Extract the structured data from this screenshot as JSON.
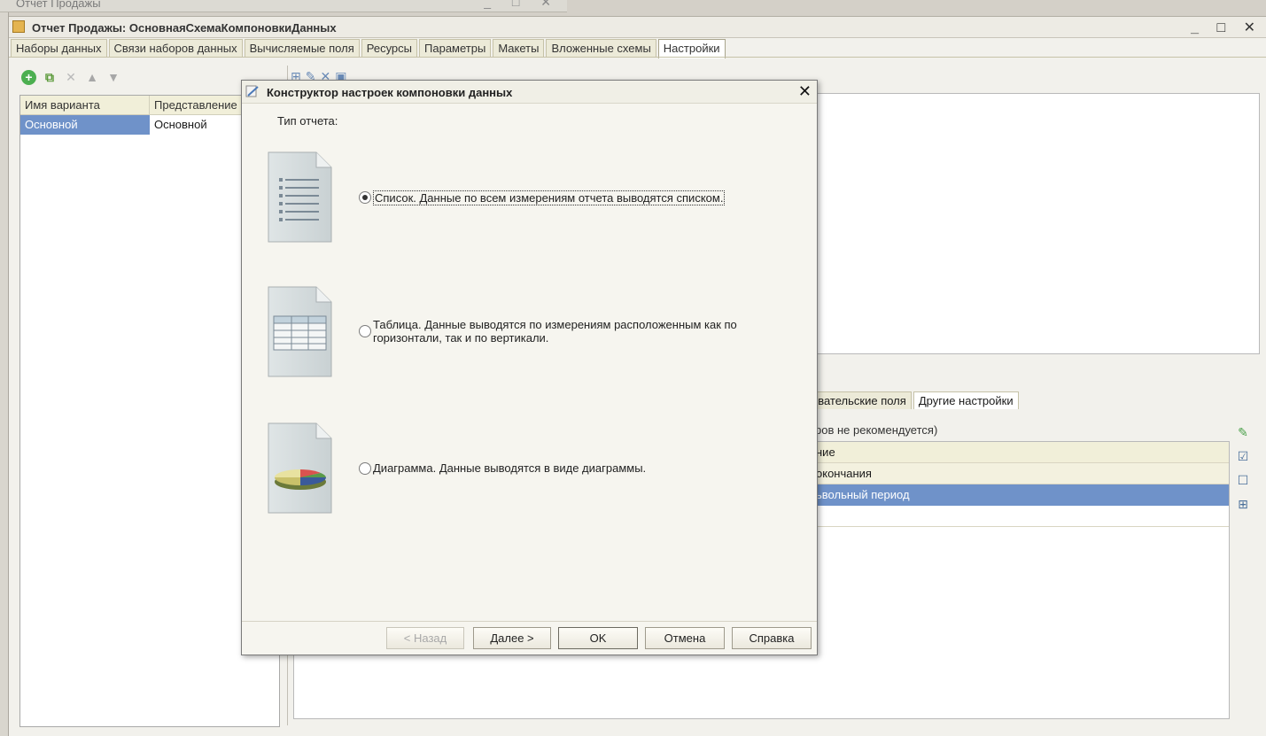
{
  "background_window": {
    "title": "Отчет Продажы"
  },
  "main_window": {
    "title": "Отчет Продажы: ОсновнаяСхемаКомпоновкиДанных",
    "tabs": [
      "Наборы данных",
      "Связи наборов данных",
      "Вычисляемые поля",
      "Ресурсы",
      "Параметры",
      "Макеты",
      "Вложенные схемы",
      "Настройки"
    ],
    "active_tab": "Настройки"
  },
  "variants": {
    "columns": [
      "Имя варианта",
      "Представление"
    ],
    "rows": [
      {
        "name": "Основной",
        "presentation": "Основной"
      }
    ]
  },
  "settings": {
    "subtabs": [
      "ователь­ские поля",
      "Другие настройки"
    ],
    "subtab_visible_1": "ователь­ские поля",
    "subtab_visible_2": "Другие настройки",
    "info": "ров не рекомендуется)",
    "params_header": "ние",
    "param_rows": [
      "окончания",
      "ьвольный период"
    ]
  },
  "dialog": {
    "title": "Конструктор настроек компоновки данных",
    "type_label": "Тип отчета:",
    "options": [
      {
        "label": "Список. Данные по всем измерениям отчета выводятся списком.",
        "selected": true,
        "icon": "list-doc-icon"
      },
      {
        "label_line1": "Таблица. Данные выводятся по измерениям расположенным как по",
        "label_line2": "горизонтали, так и по вертикали.",
        "selected": false,
        "icon": "table-doc-icon"
      },
      {
        "label": "Диаграмма. Данные выводятся в виде диаграммы.",
        "selected": false,
        "icon": "chart-doc-icon"
      }
    ],
    "buttons": {
      "back": "< Назад",
      "next": "Далее >",
      "ok": "OK",
      "cancel": "Отмена",
      "help": "Справка"
    }
  },
  "colors": {
    "selection": "#6f92c9",
    "tab_bg": "#ecead8",
    "window_bg": "#f2f1ec"
  }
}
